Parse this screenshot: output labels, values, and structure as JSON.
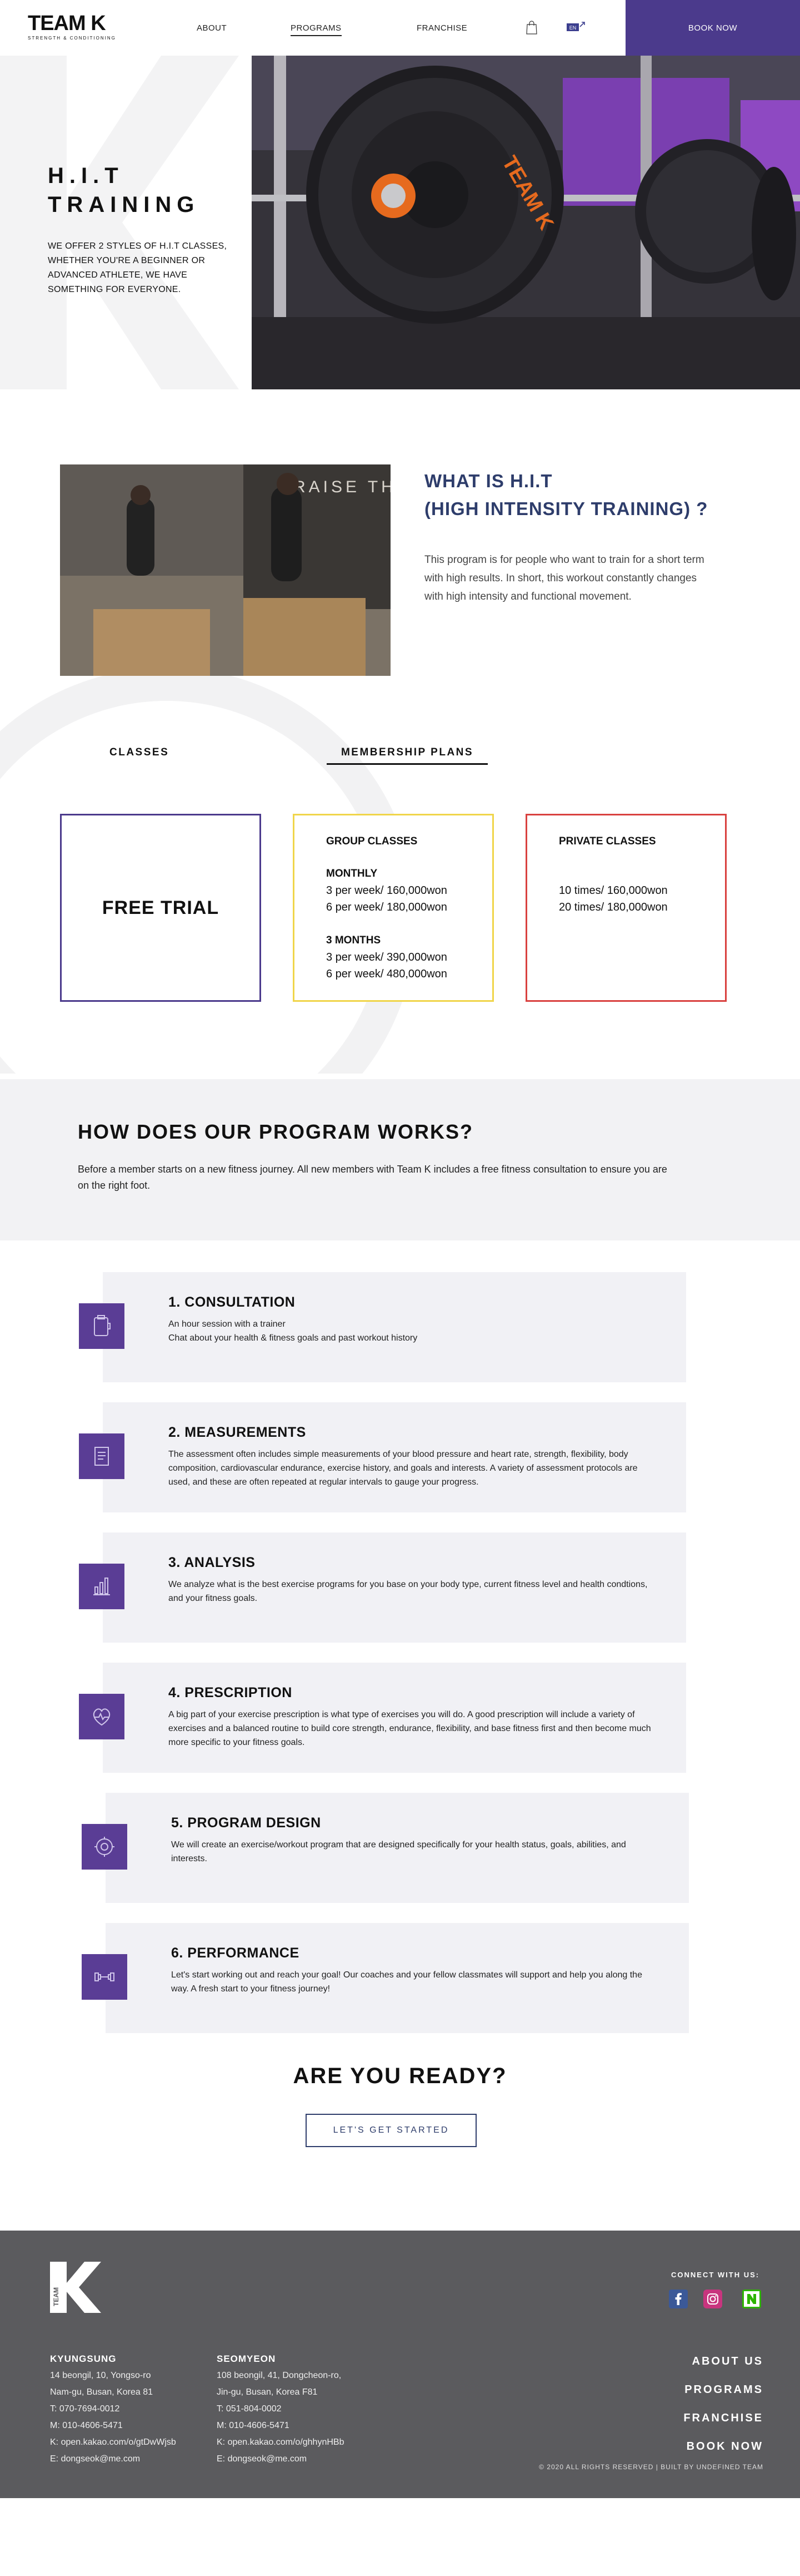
{
  "header": {
    "logo_main": "TEAM K",
    "logo_sub": "STRENGTH & CONDITIONING",
    "nav": [
      "ABOUT",
      "PROGRAMS",
      "FRANCHISE"
    ],
    "lang": "EN",
    "book_label": "BOOK NOW"
  },
  "hero": {
    "title_line1": "H.I.T",
    "title_line2": "TRAINING",
    "description": "WE OFFER 2 STYLES OF H.I.T CLASSES, WHETHER YOU'RE A BEGINNER OR ADVANCED ATHLETE, WE HAVE SOMETHING FOR EVERYONE.",
    "plate_text": "TEAM K",
    "wall_text": "RAISE THE BAR"
  },
  "what": {
    "title_line1": "WHAT IS H.I.T",
    "title_line2": "(HIGH INTENSITY TRAINING) ?",
    "text": "This program is for people who want to train for a short term with high results. In short, this workout constantly changes with high intensity and functional movement.",
    "wall_text": "RAISE THE BAR"
  },
  "tabs": {
    "classes": "CLASSES",
    "membership": "MEMBERSHIP PLANS"
  },
  "plans": {
    "free": "FREE TRIAL",
    "group": {
      "title": "GROUP CLASSES",
      "monthly_label": "MONTHLY",
      "monthly": [
        "3 per week/ 160,000won",
        "6 per week/ 180,000won"
      ],
      "three_label": "3 MONTHS",
      "three": [
        "3 per week/ 390,000won",
        "6 per week/ 480,000won"
      ]
    },
    "private": {
      "title": "PRIVATE CLASSES",
      "lines": [
        "10 times/ 160,000won",
        "20 times/ 180,000won"
      ]
    }
  },
  "how": {
    "title": "HOW DOES OUR PROGRAM WORKS?",
    "text": "Before a member starts on a new fitness journey. All new members with Team K includes a free fitness consultation to ensure you are on the right foot."
  },
  "steps": [
    {
      "title": "1. CONSULTATION",
      "icon": "clipboard-icon",
      "desc": "An hour session with a trainer\nChat about your health & fitness goals and past workout history"
    },
    {
      "title": "2. MEASUREMENTS",
      "icon": "checklist-icon",
      "desc": "The assessment often includes simple measurements of your blood pressure and heart rate, strength, flexibility, body composition, cardiovascular endurance, exercise history, and goals and interests. A variety of assessment protocols are used, and these are often repeated at regular intervals to gauge your progress."
    },
    {
      "title": "3. ANALYSIS",
      "icon": "bar-chart-icon",
      "desc": "We analyze what is the best exercise programs for you base on your body type, current fitness level and health condtions, and your fitness goals."
    },
    {
      "title": "4. PRESCRIPTION",
      "icon": "heart-pulse-icon",
      "desc": "A big part of your exercise prescription is what type of exercises you will do. A good prescription will include a variety of exercises and a balanced routine to build core strength, endurance, flexibility, and base fitness first and then become much more specific to your fitness goals."
    },
    {
      "title": "5. PROGRAM DESIGN",
      "icon": "dial-icon",
      "desc": "We will create an exercise/workout program that are designed specifically for your health status, goals, abilities, and interests."
    },
    {
      "title": "6. PERFORMANCE",
      "icon": "dumbbell-icon",
      "desc": "Let's start working out and reach your goal! Our coaches and your fellow classmates will support and help you along the way. A fresh start to your fitness journey!"
    }
  ],
  "ready": {
    "title": "ARE YOU READY?",
    "button": "LET'S GET STARTED"
  },
  "footer": {
    "logo_text": "TEAM",
    "connect": "CONNECT WITH US:",
    "kyungsung": {
      "head": "KYUNGSUNG",
      "lines": [
        "14 beongil, 10, Yongso-ro",
        "Nam-gu, Busan, Korea 81",
        "T: 070-7694-0012",
        "M: 010-4606-5471",
        "K: open.kakao.com/o/gtDwWjsb",
        "E: dongseok@me.com"
      ]
    },
    "seomyeon": {
      "head": "SEOMYEON",
      "lines": [
        "108 beongil, 41, Dongcheon-ro,",
        "Jin-gu, Busan, Korea F81",
        "T: 051-804-0002",
        "M: 010-4606-5471",
        "K: open.kakao.com/o/ghhynHBb",
        "E: dongseok@me.com"
      ]
    },
    "links": [
      "ABOUT US",
      "PROGRAMS",
      "FRANCHISE",
      "BOOK NOW"
    ],
    "copyright": "© 2020 ALL RIGHTS RESERVED | BUILT BY UNDEFINED TEAM"
  },
  "colors": {
    "brand_purple": "#4b3a8c",
    "navy": "#2e3d6b",
    "group_yellow": "#f0d54a",
    "private_red": "#d9413f",
    "footer_gray": "#5b5b5e"
  }
}
